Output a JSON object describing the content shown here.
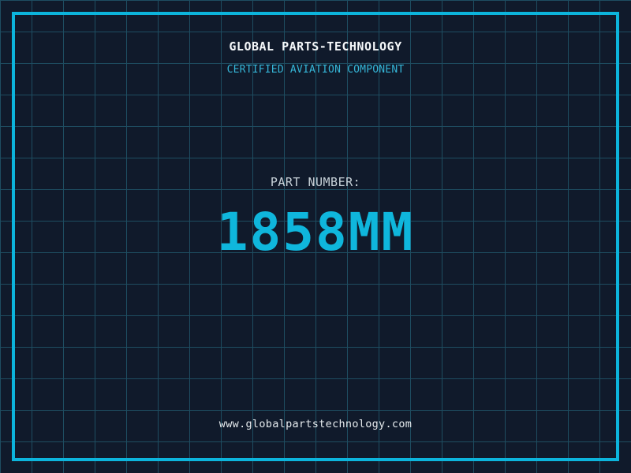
{
  "page": {
    "colors": {
      "background": "#101a2b",
      "grid_line": "#1e4d61",
      "frame_accent": "#0cb4dc",
      "title_text": "#f5f8fa",
      "tagline_text": "#35b6d8",
      "label_text": "#c9d3da",
      "part_number_text": "#0fb6dc",
      "website_text": "#e6ebee"
    }
  },
  "header": {
    "company_name": "GLOBAL PARTS-TECHNOLOGY",
    "tagline": "CERTIFIED AVIATION COMPONENT"
  },
  "part": {
    "label": "PART NUMBER:",
    "number": "1858MM"
  },
  "footer": {
    "website": "www.globalpartstechnology.com"
  }
}
